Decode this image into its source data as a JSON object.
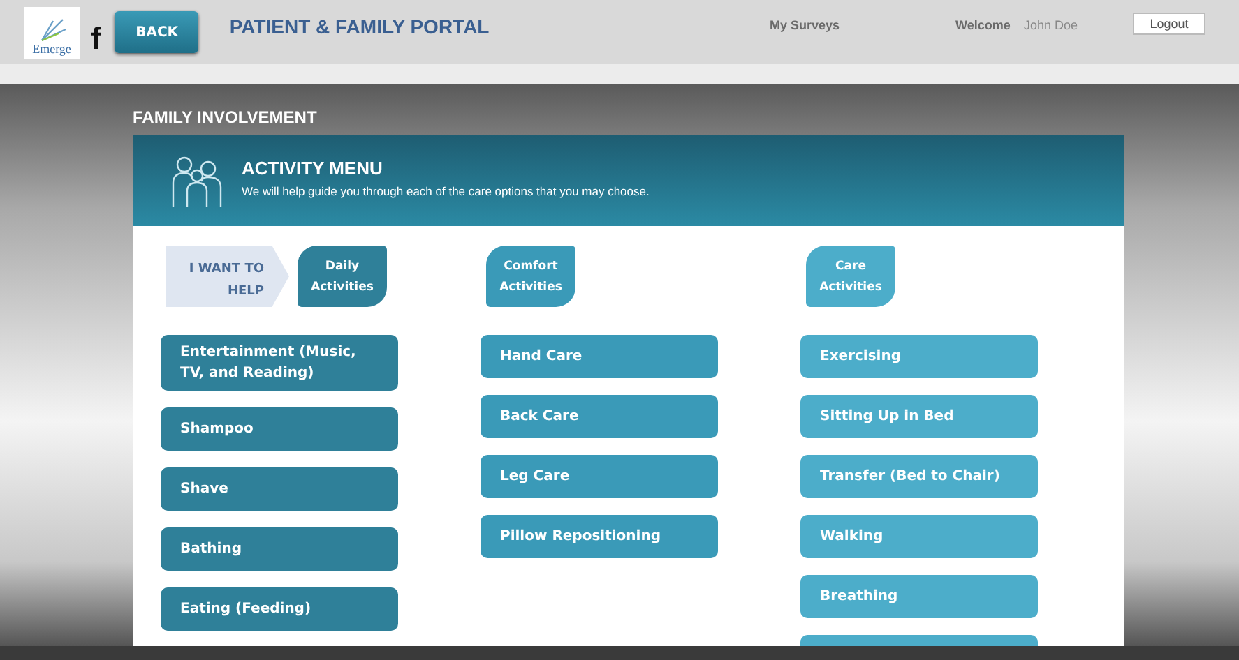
{
  "header": {
    "logo": "Emerge",
    "letter": "f",
    "back_button": "BACK",
    "title": "PATIENT & FAMILY PORTAL",
    "surveys_link": "My Surveys",
    "welcome": "Welcome",
    "user": "John Doe",
    "logout_button": "Logout"
  },
  "section_title": "FAMILY INVOLVEMENT",
  "menu": {
    "title": "ACTIVITY MENU",
    "subtitle": "We will help guide you through each of the care options that you may choose.",
    "prompt": "I WANT TO HELP",
    "columns": [
      {
        "tab": "Daily Activities",
        "color": "#2f8099",
        "items": [
          {
            "kind": "button",
            "label": "Entertainment (Music, TV, and Reading)"
          },
          {
            "kind": "button",
            "label": "Shampoo"
          },
          {
            "kind": "button",
            "label": "Shave"
          },
          {
            "kind": "button",
            "label": "Bathing"
          },
          {
            "kind": "button",
            "label": "Eating (Feeding)"
          }
        ]
      },
      {
        "tab": "Comfort Activities",
        "color": "#3a9ab8",
        "items": [
          {
            "kind": "button",
            "label": "Hand Care"
          },
          {
            "kind": "button",
            "label": "Back Care"
          },
          {
            "kind": "button",
            "label": "Leg Care"
          },
          {
            "kind": "button",
            "label": "Pillow Repositioning"
          }
        ]
      },
      {
        "tab": "Care Activities",
        "color": "#4cadca",
        "items": [
          {
            "kind": "button",
            "label": "Exercising"
          },
          {
            "kind": "button",
            "label": "Sitting Up in Bed"
          },
          {
            "kind": "button",
            "label": "Transfer (Bed to Chair)"
          },
          {
            "kind": "button",
            "label": "Walking"
          },
          {
            "kind": "button",
            "label": "Breathing"
          },
          {
            "kind": "partial"
          }
        ]
      }
    ]
  }
}
